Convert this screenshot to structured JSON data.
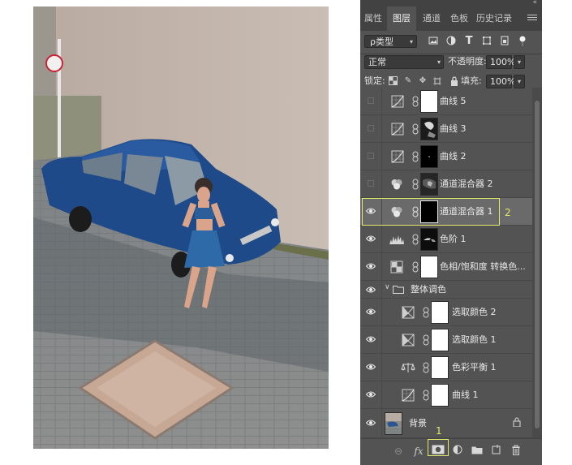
{
  "panel": {
    "tabs": [
      "属性",
      "图层",
      "通道",
      "色板",
      "历史记录"
    ],
    "active_tab": "图层",
    "filter": {
      "kind_label": "类型"
    },
    "blend_mode": "正常",
    "opacity_label": "不透明度:",
    "opacity_value": "100%",
    "lock_label": "锁定:",
    "fill_label": "填充:",
    "fill_value": "100%"
  },
  "layers": [
    {
      "name": "曲线 5",
      "visible": false,
      "type": "curves",
      "mask": "white"
    },
    {
      "name": "曲线 3",
      "visible": false,
      "type": "curves",
      "mask": "dark-photo"
    },
    {
      "name": "曲线 2",
      "visible": false,
      "type": "curves",
      "mask": "black-dot"
    },
    {
      "name": "通道混合器 2",
      "visible": false,
      "type": "mixer",
      "mask": "dark-photo"
    },
    {
      "name": "通道混合器 1",
      "visible": true,
      "type": "mixer",
      "mask": "black",
      "selected": true
    },
    {
      "name": "色阶 1",
      "visible": true,
      "type": "levels",
      "mask": "dark-car"
    },
    {
      "name": "色相/饱和度 转换色...",
      "visible": true,
      "type": "hue",
      "mask": "white"
    },
    {
      "name": "整体调色",
      "visible": true,
      "type": "group"
    },
    {
      "name": "选取颜色 2",
      "visible": true,
      "type": "selective",
      "mask": "white",
      "indent": true
    },
    {
      "name": "选取颜色 1",
      "visible": true,
      "type": "selective",
      "mask": "white",
      "indent": true
    },
    {
      "name": "色彩平衡 1",
      "visible": true,
      "type": "balance",
      "indent": true
    },
    {
      "name": "曲线 1",
      "visible": true,
      "type": "curves",
      "mask": "white",
      "indent": true
    },
    {
      "name": "背景",
      "visible": true,
      "type": "background",
      "locked": true
    }
  ],
  "annotations": [
    {
      "label": "1",
      "target": "add-mask-button"
    },
    {
      "label": "2",
      "target": "layer-channel-mixer-1"
    }
  ],
  "colors": {
    "panel_bg": "#535353",
    "highlight": "#e3e86a",
    "selected_row": "#6a6a6a"
  }
}
